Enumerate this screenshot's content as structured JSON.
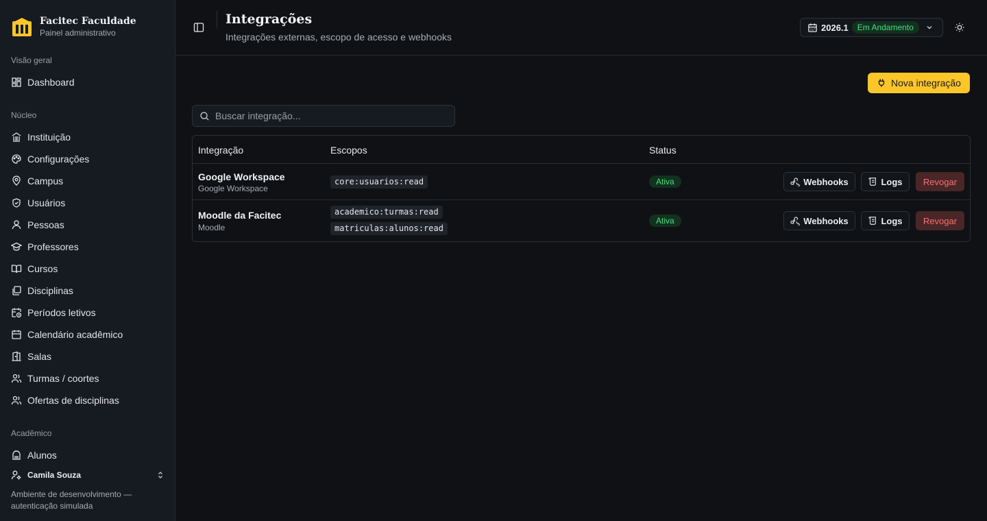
{
  "brand": {
    "title": "Facitec Faculdade",
    "subtitle": "Painel administrativo"
  },
  "sidebar": {
    "sections": [
      {
        "label": "Visão geral",
        "items": [
          {
            "label": "Dashboard",
            "icon": "dashboard-icon"
          }
        ]
      },
      {
        "label": "Núcleo",
        "items": [
          {
            "label": "Instituição",
            "icon": "landmark-icon"
          },
          {
            "label": "Configurações",
            "icon": "palette-icon"
          },
          {
            "label": "Campus",
            "icon": "map-pin-icon"
          },
          {
            "label": "Usuários",
            "icon": "shield-icon"
          },
          {
            "label": "Pessoas",
            "icon": "user-icon"
          },
          {
            "label": "Professores",
            "icon": "graduation-cap-icon"
          },
          {
            "label": "Cursos",
            "icon": "book-open-icon"
          },
          {
            "label": "Disciplinas",
            "icon": "library-icon"
          },
          {
            "label": "Períodos letivos",
            "icon": "calendar-clock-icon"
          },
          {
            "label": "Calendário acadêmico",
            "icon": "calendar-icon"
          },
          {
            "label": "Salas",
            "icon": "door-icon"
          },
          {
            "label": "Turmas / coortes",
            "icon": "users-icon"
          },
          {
            "label": "Ofertas de disciplinas",
            "icon": "users-icon"
          }
        ]
      },
      {
        "label": "Acadêmico",
        "items": [
          {
            "label": "Alunos",
            "icon": "backpack-icon"
          }
        ]
      }
    ],
    "user": "Camila Souza",
    "env_note": "Ambiente de desenvolvimento — autenticação simulada"
  },
  "header": {
    "title": "Integrações",
    "subtitle": "Integrações externas, escopo de acesso e webhooks",
    "period": {
      "year": "2026.1",
      "status": "Em Andamento"
    }
  },
  "actions": {
    "new_integration": "Nova integração"
  },
  "search": {
    "placeholder": "Buscar integração..."
  },
  "table": {
    "headers": [
      "Integração",
      "Escopos",
      "Status"
    ],
    "rows": [
      {
        "name": "Google Workspace",
        "type": "Google Workspace",
        "scopes": [
          "core:usuarios:read"
        ],
        "status": "Ativa"
      },
      {
        "name": "Moodle da Facitec",
        "type": "Moodle",
        "scopes": [
          "academico:turmas:read",
          "matriculas:alunos:read"
        ],
        "status": "Ativa"
      }
    ],
    "row_actions": {
      "webhooks": "Webhooks",
      "logs": "Logs",
      "revoke": "Revogar"
    }
  },
  "colors": {
    "accent": "#fcc62b",
    "status_active": "#4ade80",
    "danger": "#f87171",
    "background": "#0f1115",
    "sidebar": "#161a21"
  }
}
